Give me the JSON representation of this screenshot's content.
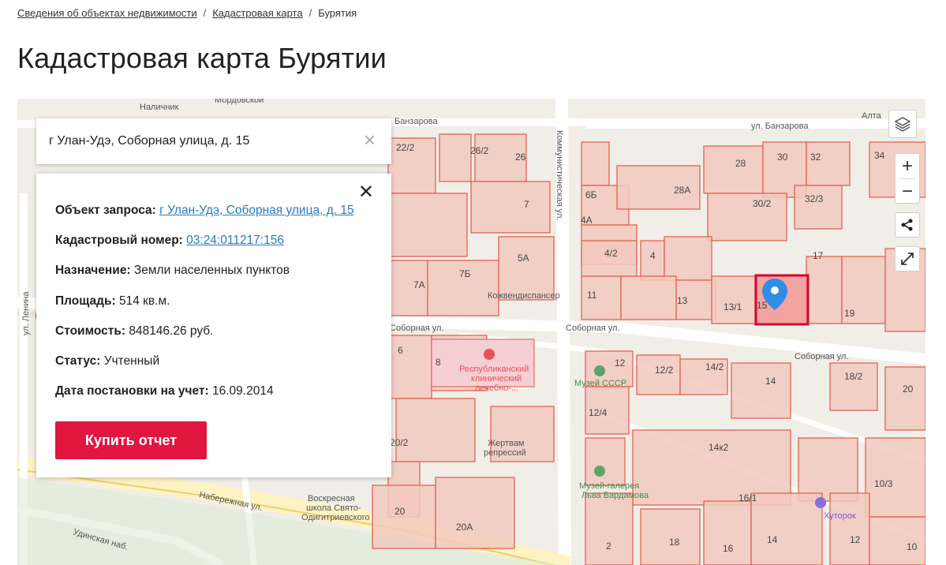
{
  "breadcrumb": {
    "items": [
      "Сведения об объектах недвижимости",
      "Кадастровая карта",
      "Бурятия"
    ],
    "separator": "/"
  },
  "page": {
    "title": "Кадастровая карта Бурятии"
  },
  "search": {
    "value": "г Улан-Удэ, Соборная улица, д. 15",
    "clear_icon": "×"
  },
  "info": {
    "close_icon": "✕",
    "object_label": "Объект запроса:",
    "object_value": "г Улан-Удэ, Соборная улица, д. 15",
    "cadnum_label": "Кадастровый номер:",
    "cadnum_value": "03:24:011217:156",
    "purpose_label": "Назначение:",
    "purpose_value": "Земли населенных пунктов",
    "area_label": "Площадь:",
    "area_value": "514 кв.м.",
    "cost_label": "Стоимость:",
    "cost_value": "848146.26 руб.",
    "status_label": "Статус:",
    "status_value": "Учтенный",
    "date_label": "Дата постановки на учет:",
    "date_value": "16.09.2014",
    "buy_label": "Купить отчет"
  },
  "controls": {
    "zoom_in": "+",
    "zoom_out": "−"
  },
  "map": {
    "streets": [
      "Наличник",
      "Мордовской",
      "Банзарова",
      "ул. Банзарова",
      "Алта",
      "Коммунистическая ул.",
      "ул. Ленина",
      "Соборная ул.",
      "Соборная ул.",
      "Соборная ул.",
      "Набережная ул.",
      "Удинская наб."
    ],
    "pois": [
      "Кожвендиспансер",
      "Республиканский",
      "клинический",
      "лечебно-...",
      "Музей СССР",
      "Жертвам",
      "репрессий",
      "Воскресная",
      "школа Свято-",
      "Одигитриевского",
      "Музей-галерея",
      "Льва Бардамова",
      "Хуторок"
    ],
    "houses": [
      "22/2",
      "26/2",
      "26",
      "7",
      "5А",
      "7А",
      "7Б",
      "6Б",
      "4А",
      "28",
      "30",
      "32",
      "28А",
      "30/2",
      "32/3",
      "34",
      "4/2",
      "4",
      "11",
      "13",
      "13/1",
      "15",
      "17",
      "19",
      "6",
      "8",
      "12",
      "12/2",
      "14/2",
      "14",
      "18/2",
      "20",
      "12/4",
      "20/2",
      "14к2",
      "16/1",
      "10/3",
      "20",
      "20А",
      "2",
      "18",
      "16",
      "14",
      "12",
      "10"
    ],
    "colors": {
      "parcel_fill": "#f2c9be",
      "parcel_stroke": "#e05a4a",
      "selected": "#d10a2f",
      "marker": "#2f8de4"
    }
  }
}
